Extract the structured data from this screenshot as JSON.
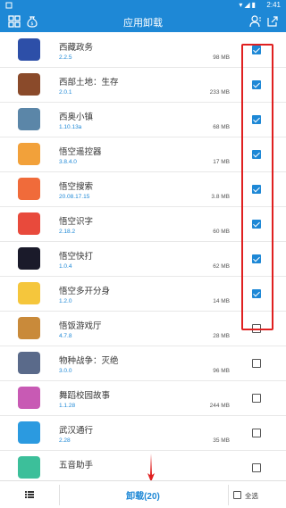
{
  "status_bar": {
    "time": "2:41"
  },
  "toolbar": {
    "title": "应用卸载"
  },
  "apps": [
    {
      "name": "西藏政务",
      "version": "2.2.5",
      "size": "98 MB",
      "checked": true,
      "icon_color": "#2d4fa8",
      "icon_name": "xizang-zhengwu-app-icon"
    },
    {
      "name": "西部土地：生存",
      "version": "2.0.1",
      "size": "233 MB",
      "checked": true,
      "icon_color": "#8a4a2a",
      "icon_name": "west-land-survival-app-icon"
    },
    {
      "name": "西奥小镇",
      "version": "1.10.13a",
      "size": "68 MB",
      "checked": true,
      "icon_color": "#5b86a8",
      "icon_name": "xiao-town-app-icon"
    },
    {
      "name": "悟空遥控器",
      "version": "3.8.4.0",
      "size": "17 MB",
      "checked": true,
      "icon_color": "#f2a13a",
      "icon_name": "wukong-remote-app-icon"
    },
    {
      "name": "悟空搜索",
      "version": "20.08.17.15",
      "size": "3.8 MB",
      "checked": true,
      "icon_color": "#f06b3a",
      "icon_name": "wukong-search-app-icon"
    },
    {
      "name": "悟空识字",
      "version": "2.18.2",
      "size": "60 MB",
      "checked": true,
      "icon_color": "#e84a3c",
      "icon_name": "wukong-literacy-app-icon"
    },
    {
      "name": "悟空快打",
      "version": "1.0.4",
      "size": "62 MB",
      "checked": true,
      "icon_color": "#1a1a2a",
      "icon_name": "wukong-fight-app-icon"
    },
    {
      "name": "悟空多开分身",
      "version": "1.2.0",
      "size": "14 MB",
      "checked": true,
      "icon_color": "#f5c63c",
      "icon_name": "wukong-multi-app-icon"
    },
    {
      "name": "悟饭游戏厅",
      "version": "4.7.8",
      "size": "28 MB",
      "checked": false,
      "icon_color": "#c98a3a",
      "icon_name": "wufan-game-app-icon"
    },
    {
      "name": "物种战争：灭绝",
      "version": "3.0.0",
      "size": "96 MB",
      "checked": false,
      "icon_color": "#5a6a8a",
      "icon_name": "species-war-app-icon"
    },
    {
      "name": "舞蹈校园故事",
      "version": "1.1.28",
      "size": "244 MB",
      "checked": false,
      "icon_color": "#c85ab4",
      "icon_name": "dance-campus-app-icon"
    },
    {
      "name": "武汉通行",
      "version": "2.28",
      "size": "35 MB",
      "checked": false,
      "icon_color": "#2b9ae0",
      "icon_name": "wuhan-pass-app-icon"
    },
    {
      "name": "五音助手",
      "version": "",
      "size": "",
      "checked": false,
      "icon_color": "#3cbf9a",
      "icon_name": "wuyin-helper-app-icon"
    }
  ],
  "bottom_bar": {
    "uninstall_label": "卸载(20)",
    "select_all_label": "全选"
  },
  "colors": {
    "accent": "#1e88d6",
    "highlight": "#e02020"
  }
}
